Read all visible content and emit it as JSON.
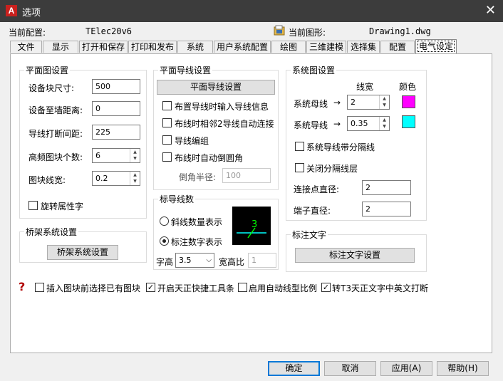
{
  "window": {
    "title": "选项",
    "close_glyph": "✕"
  },
  "header": {
    "current_config_label": "当前配置:",
    "current_config_value": "TElec20v6",
    "current_drawing_label": "当前图形:",
    "current_drawing_value": "Drawing1.dwg"
  },
  "tabs": [
    "文件",
    "显示",
    "打开和保存",
    "打印和发布",
    "系统",
    "用户系统配置",
    "绘图",
    "三维建模",
    "选择集",
    "配置",
    "电气设定"
  ],
  "active_tab": "电气设定",
  "plan_settings": {
    "title": "平面图设置",
    "block_size_label": "设备块尺寸:",
    "block_size_value": "500",
    "wall_distance_label": "设备至墙距离:",
    "wall_distance_value": "0",
    "wire_break_label": "导线打断间距:",
    "wire_break_value": "225",
    "hf_blocks_label": "高频图块个数:",
    "hf_blocks_value": "6",
    "block_linewidth_label": "图块线宽:",
    "block_linewidth_value": "0.2",
    "rotate_attr_label": "旋转属性字",
    "rotate_attr_checked": false
  },
  "bridge": {
    "title": "桥架系统设置",
    "button": "桥架系统设置"
  },
  "plan_wire": {
    "title": "平面导线设置",
    "button": "平面导线设置",
    "opt1": "布置导线时输入导线信息",
    "opt1_checked": false,
    "opt2": "布线时相邻2导线自动连接",
    "opt2_checked": false,
    "opt3": "导线编组",
    "opt3_checked": false,
    "opt4": "布线时自动倒圆角",
    "opt4_checked": false,
    "radius_label": "倒角半径:",
    "radius_value": "100"
  },
  "wire_count": {
    "title": "标导线数",
    "radio1": "斜线数量表示",
    "radio1_on": false,
    "radio2": "标注数字表示",
    "radio2_on": true,
    "font_height_label": "字高",
    "font_height_value": "3.5",
    "ratio_label": "宽高比",
    "ratio_value": "1",
    "preview_number": "3"
  },
  "system_settings": {
    "title": "系统图设置",
    "col_linewidth": "线宽",
    "col_color": "颜色",
    "bus_label": "系统母线",
    "bus_width": "2",
    "bus_color": "#ff00ff",
    "wire_label": "系统导线",
    "wire_width": "0.35",
    "wire_color": "#00ffff",
    "arrow": "→",
    "gap_label": "系统导线带分隔线",
    "gap_checked": false,
    "close_layer_label": "关闭分隔线层",
    "close_layer_checked": false,
    "joint_label": "连接点直径:",
    "joint_value": "2",
    "terminal_label": "端子直径:",
    "terminal_value": "2"
  },
  "annotation": {
    "title": "标注文字",
    "button": "标注文字设置"
  },
  "bottom_options": {
    "help_glyph": "?",
    "opt1": "插入图块前选择已有图块",
    "opt1_checked": false,
    "opt2": "开启天正快捷工具条",
    "opt2_checked": true,
    "opt3": "启用自动线型比例",
    "opt3_checked": false,
    "opt4": "转T3天正文字中英文打断",
    "opt4_checked": true
  },
  "footer": {
    "ok": "确定",
    "cancel": "取消",
    "apply": "应用(A)",
    "help": "帮助(H)"
  },
  "colors": {
    "title_bar": "#3c3c3c",
    "focus_blue": "#0078d7"
  }
}
